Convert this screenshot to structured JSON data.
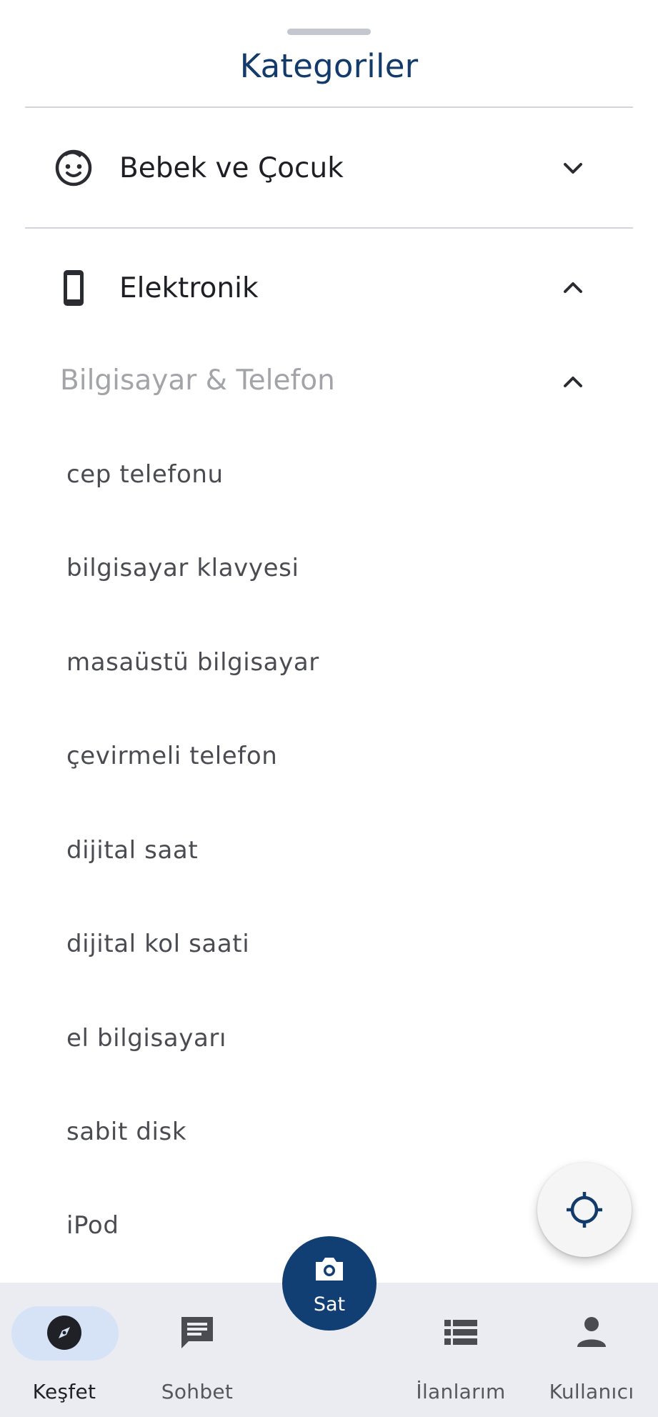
{
  "sheet": {
    "title": "Kategoriler"
  },
  "categories": [
    {
      "label": "Bebek ve Çocuk",
      "icon": "baby-face-icon",
      "expanded": false
    },
    {
      "label": "Elektronik",
      "icon": "smartphone-icon",
      "expanded": true
    }
  ],
  "subcategory": {
    "label": "Bilgisayar & Telefon",
    "expanded": true,
    "items": [
      "cep telefonu",
      "bilgisayar klavyesi",
      "masaüstü bilgisayar",
      "çevirmeli telefon",
      "dijital saat",
      "dijital kol saati",
      "el bilgisayarı",
      "sabit disk",
      "iPod"
    ]
  },
  "locate_button": {
    "icon": "crosshair-icon"
  },
  "sell_button": {
    "label": "Sat",
    "icon": "camera-icon"
  },
  "bottom_nav": [
    {
      "label": "Keşfet",
      "icon": "compass-icon",
      "active": true
    },
    {
      "label": "Sohbet",
      "icon": "chat-icon",
      "active": false
    },
    {
      "label": "İlanlarım",
      "icon": "list-icon",
      "active": false
    },
    {
      "label": "Kullanıcı",
      "icon": "person-icon",
      "active": false
    }
  ],
  "colors": {
    "primary": "#123f73",
    "title": "#123a6b",
    "nav_background": "#eaecf1",
    "active_pill": "#d6e2f6"
  }
}
